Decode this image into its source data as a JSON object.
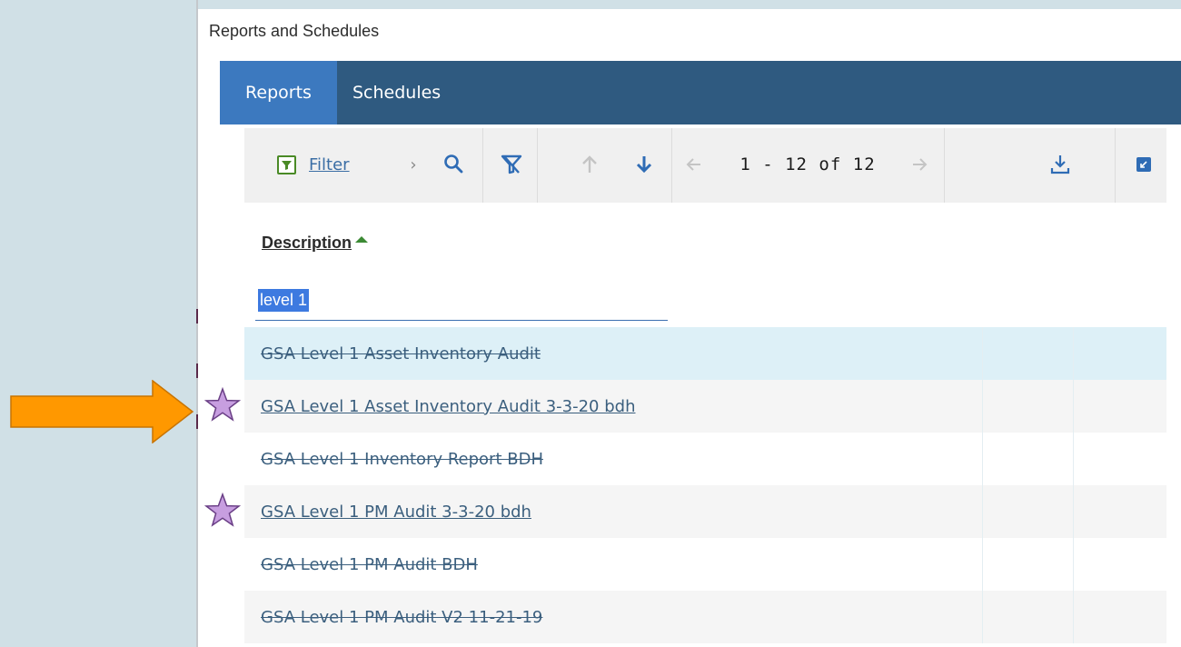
{
  "window": {
    "title": "Reports and Schedules"
  },
  "tabs": [
    {
      "label": "Reports",
      "active": true
    },
    {
      "label": "Schedules",
      "active": false
    }
  ],
  "toolbar": {
    "filter_label": "Filter",
    "pager": "1 - 12 of 12"
  },
  "table": {
    "column_header": "Description",
    "sort_direction": "ascending",
    "filter_value": "level 1",
    "rows": [
      {
        "label": "GSA Level 1 Asset Inventory Audit",
        "struck": true,
        "starred": false,
        "selected": true
      },
      {
        "label": "GSA Level 1 Asset Inventory Audit 3-3-20 bdh",
        "struck": false,
        "starred": true,
        "selected": false
      },
      {
        "label": "GSA Level 1 Inventory Report BDH",
        "struck": true,
        "starred": false,
        "selected": false
      },
      {
        "label": "GSA Level 1 PM Audit 3-3-20 bdh",
        "struck": false,
        "starred": true,
        "selected": false
      },
      {
        "label": "GSA Level 1 PM Audit BDH",
        "struck": true,
        "starred": false,
        "selected": false
      },
      {
        "label": "GSA Level 1 PM Audit V2 11-21-19",
        "struck": true,
        "starred": false,
        "selected": false
      }
    ]
  },
  "annotations": {
    "arrow_color": "#ff9800",
    "star_color": "#c79ee0"
  },
  "colors": {
    "tabbar": "#2f5a80",
    "active_tab": "#3c79bf",
    "link": "#3b5f7e",
    "selected_row": "#ddf0f7",
    "filter_highlight": "#3d7ae0"
  }
}
